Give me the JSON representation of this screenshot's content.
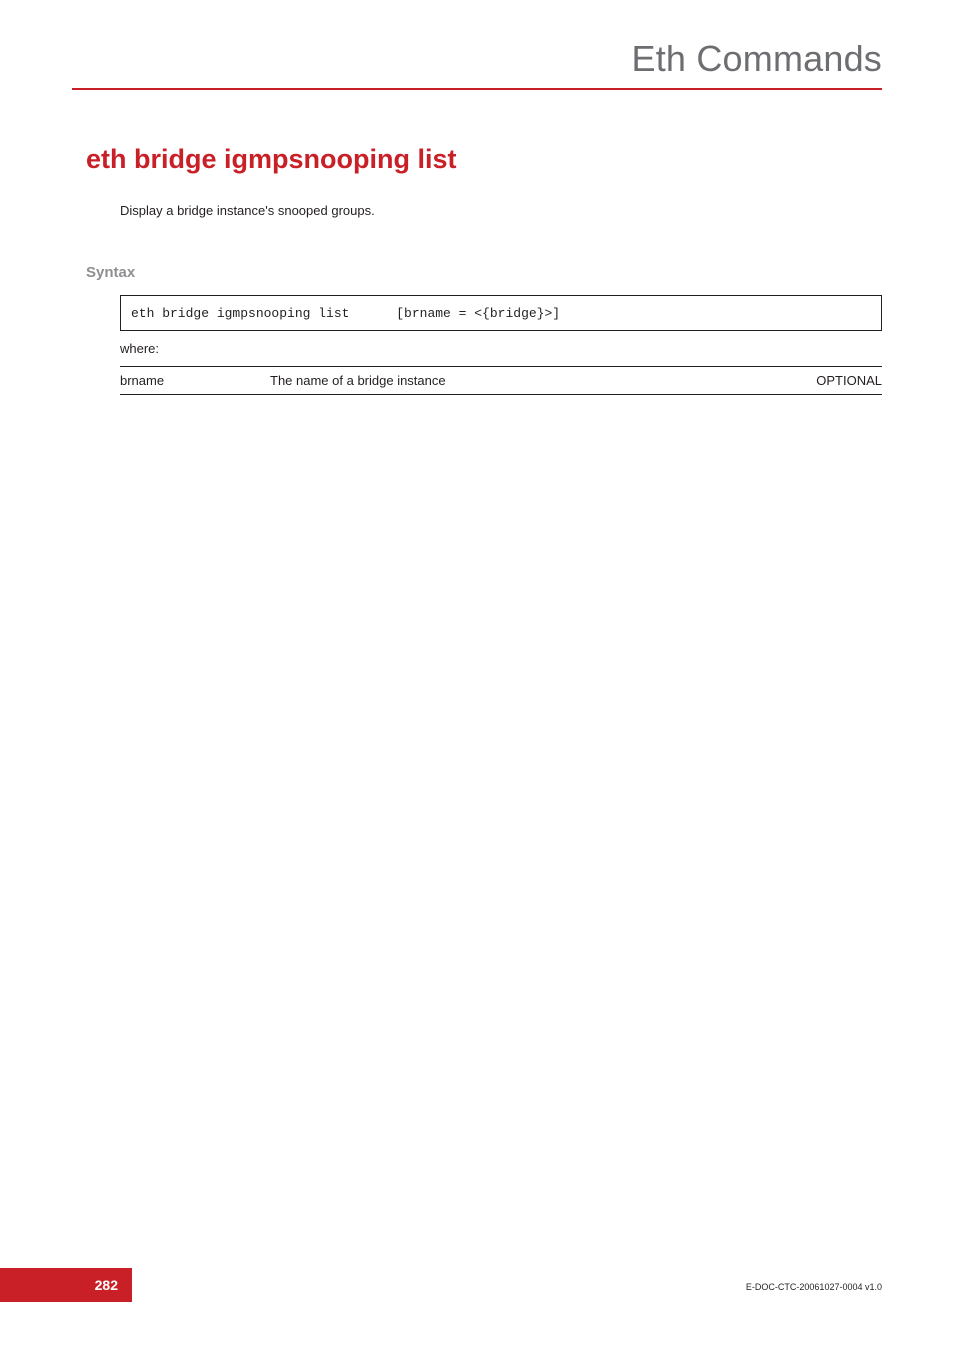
{
  "header": {
    "title": "Eth Commands"
  },
  "command": {
    "title": "eth bridge igmpsnooping list",
    "description": "Display a bridge instance's  snooped groups."
  },
  "syntax": {
    "label": "Syntax",
    "code": "eth bridge igmpsnooping list      [brname = <{bridge}>]",
    "where_label": "where:"
  },
  "params": [
    {
      "name": "brname",
      "description": "The name of a bridge instance",
      "optionality": "OPTIONAL"
    }
  ],
  "footer": {
    "page_number": "282",
    "doc_id": "E-DOC-CTC-20061027-0004 v1.0"
  }
}
